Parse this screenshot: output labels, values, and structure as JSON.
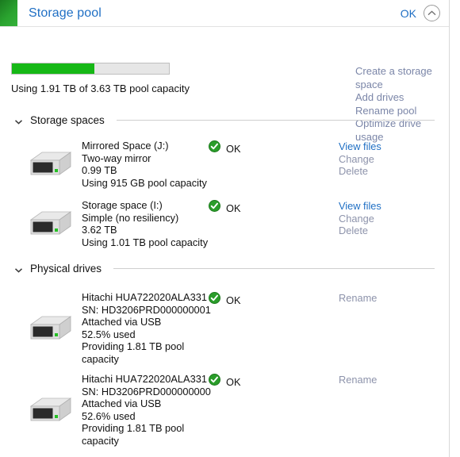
{
  "header": {
    "title": "Storage pool",
    "ok_label": "OK",
    "collapse_icon": "chevron-up-icon"
  },
  "pool": {
    "used_percent": 52.6,
    "capacity_text": "Using 1.91 TB of 3.63 TB pool capacity",
    "bar_color": "#16b816",
    "actions": [
      {
        "label": "Create a storage space",
        "enabled": false
      },
      {
        "label": "Add drives",
        "enabled": false
      },
      {
        "label": "Rename pool",
        "enabled": false
      },
      {
        "label": "Optimize drive usage",
        "enabled": false
      }
    ]
  },
  "sections": {
    "storage_spaces": {
      "label": "Storage spaces",
      "chevron_icon": "chevron-down-icon",
      "items": [
        {
          "icon": "drive-icon",
          "lines": [
            "Mirrored Space (J:)",
            "Two-way mirror",
            "0.99 TB",
            "Using 915 GB pool capacity"
          ],
          "status": "OK",
          "status_icon": "check-circle-icon",
          "actions": [
            {
              "label": "View files",
              "enabled": true
            },
            {
              "label": "Change",
              "enabled": false
            },
            {
              "label": "Delete",
              "enabled": false
            }
          ]
        },
        {
          "icon": "drive-icon",
          "lines": [
            "Storage space (I:)",
            "Simple (no resiliency)",
            "3.62 TB",
            "Using 1.01 TB pool capacity"
          ],
          "status": "OK",
          "status_icon": "check-circle-icon",
          "actions": [
            {
              "label": "View files",
              "enabled": true
            },
            {
              "label": "Change",
              "enabled": false
            },
            {
              "label": "Delete",
              "enabled": false
            }
          ]
        }
      ]
    },
    "physical_drives": {
      "label": "Physical drives",
      "chevron_icon": "chevron-down-icon",
      "items": [
        {
          "icon": "drive-icon",
          "lines": [
            "Hitachi HUA722020ALA331",
            "SN: HD3206PRD000000001",
            "Attached via USB",
            "52.5% used",
            "Providing 1.81 TB pool capacity"
          ],
          "status": "OK",
          "status_icon": "check-circle-icon",
          "actions": [
            {
              "label": "Rename",
              "enabled": false
            }
          ]
        },
        {
          "icon": "drive-icon",
          "lines": [
            "Hitachi HUA722020ALA331",
            "SN: HD3206PRD000000000",
            "Attached via USB",
            "52.6% used",
            "Providing 1.81 TB pool capacity"
          ],
          "status": "OK",
          "status_icon": "check-circle-icon",
          "actions": [
            {
              "label": "Rename",
              "enabled": false
            }
          ]
        }
      ]
    }
  }
}
